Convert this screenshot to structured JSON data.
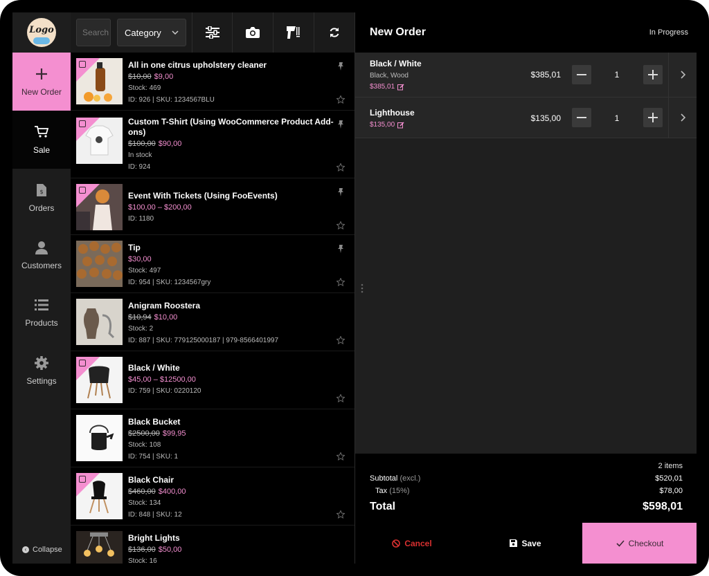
{
  "logo": {
    "text": "Logo"
  },
  "sidebar": {
    "items": [
      {
        "label": "New Order",
        "icon": "plus-icon"
      },
      {
        "label": "Sale",
        "icon": "cart-icon"
      },
      {
        "label": "Orders",
        "icon": "receipt-icon"
      },
      {
        "label": "Customers",
        "icon": "user-icon"
      },
      {
        "label": "Products",
        "icon": "list-icon"
      },
      {
        "label": "Settings",
        "icon": "gear-icon"
      }
    ],
    "collapse_label": "Collapse"
  },
  "toolbar": {
    "search_placeholder": "Search",
    "category_label": "Category"
  },
  "products": [
    {
      "name": "All in one citrus upholstery cleaner",
      "old_price": "$10,00",
      "price": "$9,00",
      "meta1": "Stock: 469",
      "meta2": "ID: 926 | SKU: 1234567BLU"
    },
    {
      "name": "Custom T-Shirt (Using WooCommerce Product Add-ons)",
      "old_price": "$100,00",
      "price": "$90,00",
      "meta1": "In stock",
      "meta2": "ID: 924"
    },
    {
      "name": "Event With Tickets (Using FooEvents)",
      "old_price": "",
      "price": "$100,00 – $200,00",
      "meta1": "ID: 1180",
      "meta2": ""
    },
    {
      "name": "Tip",
      "old_price": "",
      "price": "$30,00",
      "meta1": "Stock: 497",
      "meta2": "ID: 954 | SKU: 1234567gry"
    },
    {
      "name": "Anigram Roostera",
      "old_price": "$10,94",
      "price": "$10,00",
      "meta1": "Stock: 2",
      "meta2": "ID: 887 | SKU: 779125000187 | 979-8566401997"
    },
    {
      "name": "Black / White",
      "old_price": "",
      "price": "$45,00 – $12500,00",
      "meta1": "ID: 759 | SKU: 0220120",
      "meta2": ""
    },
    {
      "name": "Black Bucket",
      "old_price": "$2500,00",
      "price": "$99,95",
      "meta1": "Stock: 108",
      "meta2": "ID: 754 | SKU: 1"
    },
    {
      "name": "Black Chair",
      "old_price": "$460,00",
      "price": "$400,00",
      "meta1": "Stock: 134",
      "meta2": "ID: 848 | SKU: 12"
    },
    {
      "name": "Bright Lights",
      "old_price": "$136,00",
      "price": "$50,00",
      "meta1": "Stock: 16",
      "meta2": ""
    }
  ],
  "order": {
    "title": "New Order",
    "status": "In Progress",
    "lines": [
      {
        "name": "Black / White",
        "sub": "Black, Wood",
        "unit_price": "$385,01",
        "price": "$385,01",
        "qty": "1"
      },
      {
        "name": "Lighthouse",
        "sub": "",
        "unit_price": "$135,00",
        "price": "$135,00",
        "qty": "1"
      }
    ],
    "items_count": "2 items",
    "subtotal_label": "Subtotal",
    "subtotal_note": "(excl.)",
    "subtotal": "$520,01",
    "tax_label": "Tax",
    "tax_note": "(15%)",
    "tax": "$78,00",
    "total_label": "Total",
    "total": "$598,01"
  },
  "actions": {
    "cancel": "Cancel",
    "save": "Save",
    "checkout": "Checkout"
  },
  "colors": {
    "accent": "#f48fd0",
    "danger": "#d93030",
    "background": "#1a1a1a"
  }
}
